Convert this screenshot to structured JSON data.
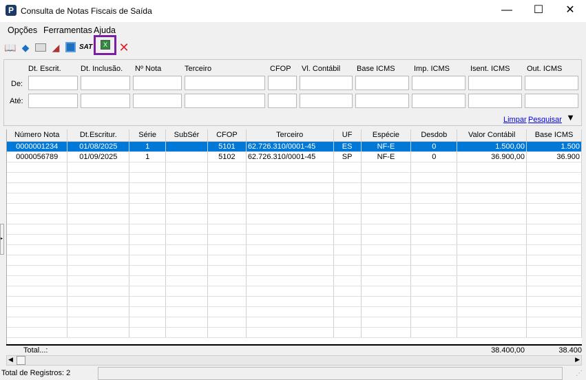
{
  "window": {
    "title": "Consulta de Notas Fiscais de Saída",
    "minimize": "—",
    "maximize": "☐",
    "close": "✕"
  },
  "menu": [
    "Opções",
    "Ferramentas",
    "Ajuda"
  ],
  "toolbar": {
    "icons": [
      "open-book-icon",
      "blue-book-icon",
      "window-icon",
      "eraser-icon",
      "blue-document-icon",
      "sat-icon",
      "export-excel-icon",
      "close-x-icon"
    ],
    "sat_label": "SAT",
    "accent": "#7a1fa2"
  },
  "filter": {
    "labels": [
      "Dt. Escrit.",
      "Dt. Inclusão.",
      "Nº Nota",
      "Terceiro",
      "CFOP",
      "Vl. Contábil",
      "Base ICMS",
      "Imp. ICMS",
      "Isent. ICMS",
      "Out. ICMS"
    ],
    "row_de": "De:",
    "row_ate": "Até:",
    "limpar": "Limpar",
    "pesquisar": "Pesquisar"
  },
  "grid": {
    "columns": [
      "Número Nota",
      "Dt.Escritur.",
      "Série",
      "SubSér",
      "CFOP",
      "Terceiro",
      "UF",
      "Espécie",
      "Desdob",
      "Valor Contábil",
      "Base ICMS"
    ],
    "rows": [
      [
        "0000001234",
        "01/08/2025",
        "1",
        "",
        "5101",
        "62.726.310/0001-45",
        "ES",
        "NF-E",
        "0",
        "1.500,00",
        "1.500"
      ],
      [
        "0000056789",
        "01/09/2025",
        "1",
        "",
        "5102",
        "62.726.310/0001-45",
        "SP",
        "NF-E",
        "0",
        "36.900,00",
        "36.900"
      ]
    ],
    "total_label": "Total...:",
    "total_valor": "38.400,00",
    "total_base": "38.400"
  },
  "status": {
    "registros": "Total de Registros: 2"
  }
}
